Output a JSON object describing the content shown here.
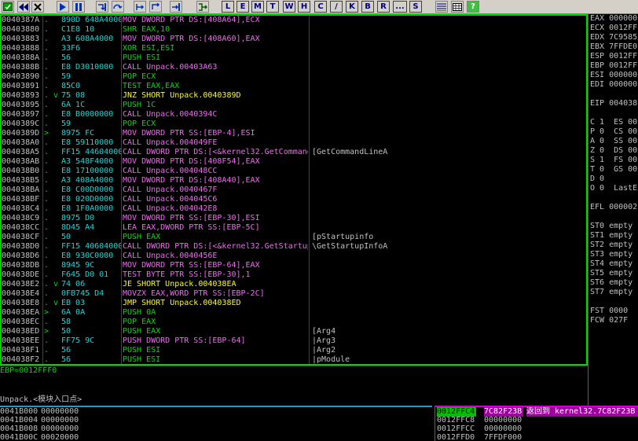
{
  "toolbar": {
    "icons": [
      "open-icon",
      "rewind-icon",
      "close-icon",
      "run-icon",
      "pause-icon",
      "step-into-icon",
      "step-over-icon",
      "trace-into-icon",
      "trace-over-icon",
      "execute-till-return-icon",
      "goto-icon"
    ],
    "letters": [
      "L",
      "E",
      "M",
      "T",
      "W",
      "H",
      "C",
      "/",
      "K",
      "B",
      "R",
      "...",
      "S"
    ],
    "right_icons": [
      "list-icon",
      "grid-icon",
      "help-icon"
    ]
  },
  "cpu": {
    "rows": [
      {
        "addr": "0040387A",
        "mark": ".",
        "hex": "890D 648A4000",
        "dis": "MOV DWORD PTR DS:[408A64],ECX",
        "type": "mov",
        "comment": ""
      },
      {
        "addr": "00403880",
        "mark": ".",
        "hex": "C1E8 10",
        "dis": "SHR EAX,10",
        "type": "default",
        "comment": ""
      },
      {
        "addr": "00403883",
        "mark": ".",
        "hex": "A3 608A4000",
        "dis": "MOV DWORD PTR DS:[408A60],EAX",
        "type": "mov",
        "comment": ""
      },
      {
        "addr": "00403888",
        "mark": ".",
        "hex": "33F6",
        "dis": "XOR ESI,ESI",
        "type": "default",
        "comment": ""
      },
      {
        "addr": "0040388A",
        "mark": ".",
        "hex": "56",
        "dis": "PUSH ESI",
        "type": "default",
        "comment": ""
      },
      {
        "addr": "0040388B",
        "mark": ".",
        "hex": "E8 D3010000",
        "dis": "CALL Unpack.00403A63",
        "type": "call",
        "comment": ""
      },
      {
        "addr": "00403890",
        "mark": ".",
        "hex": "59",
        "dis": "POP ECX",
        "type": "default",
        "comment": ""
      },
      {
        "addr": "00403891",
        "mark": ".",
        "hex": "85C0",
        "dis": "TEST EAX,EAX",
        "type": "default",
        "comment": ""
      },
      {
        "addr": "00403893",
        "mark": ". v",
        "hex": "75 08",
        "dis": "JNZ SHORT Unpack.0040389D",
        "type": "jmp",
        "comment": ""
      },
      {
        "addr": "00403895",
        "mark": ".",
        "hex": "6A 1C",
        "dis": "PUSH 1C",
        "type": "default",
        "comment": ""
      },
      {
        "addr": "00403897",
        "mark": ".",
        "hex": "E8 B0000000",
        "dis": "CALL Unpack.0040394C",
        "type": "call",
        "comment": ""
      },
      {
        "addr": "0040389C",
        "mark": ".",
        "hex": "59",
        "dis": "POP ECX",
        "type": "default",
        "comment": ""
      },
      {
        "addr": "0040389D",
        "mark": "> ",
        "hex": "8975 FC",
        "dis": "MOV DWORD PTR SS:[EBP-4],ESI",
        "type": "mov",
        "comment": ""
      },
      {
        "addr": "004038A0",
        "mark": ".",
        "hex": "E8 59110000",
        "dis": "CALL Unpack.004049FE",
        "type": "call",
        "comment": ""
      },
      {
        "addr": "004038A5",
        "mark": ".",
        "hex": "FF15 44604000",
        "dis": "CALL DWORD PTR DS:[<&kernel32.GetCommand",
        "type": "call",
        "comment": "[GetCommandLineA"
      },
      {
        "addr": "004038AB",
        "mark": ".",
        "hex": "A3 548F4000",
        "dis": "MOV DWORD PTR DS:[408F54],EAX",
        "type": "mov",
        "comment": ""
      },
      {
        "addr": "004038B0",
        "mark": ".",
        "hex": "E8 17100000",
        "dis": "CALL Unpack.004048CC",
        "type": "call",
        "comment": ""
      },
      {
        "addr": "004038B5",
        "mark": ".",
        "hex": "A3 408A4000",
        "dis": "MOV DWORD PTR DS:[408A40],EAX",
        "type": "mov",
        "comment": ""
      },
      {
        "addr": "004038BA",
        "mark": ".",
        "hex": "E8 C00D0000",
        "dis": "CALL Unpack.0040467F",
        "type": "call",
        "comment": ""
      },
      {
        "addr": "004038BF",
        "mark": ".",
        "hex": "E8 020D0000",
        "dis": "CALL Unpack.004045C6",
        "type": "call",
        "comment": ""
      },
      {
        "addr": "004038C4",
        "mark": ".",
        "hex": "E8 1F0A0000",
        "dis": "CALL Unpack.004042E8",
        "type": "call",
        "comment": ""
      },
      {
        "addr": "004038C9",
        "mark": ".",
        "hex": "8975 D0",
        "dis": "MOV DWORD PTR SS:[EBP-30],ESI",
        "type": "mov",
        "comment": ""
      },
      {
        "addr": "004038CC",
        "mark": ".",
        "hex": "8D45 A4",
        "dis": "LEA EAX,DWORD PTR SS:[EBP-5C]",
        "type": "mov",
        "comment": ""
      },
      {
        "addr": "004038CF",
        "mark": ".",
        "hex": "50",
        "dis": "PUSH EAX",
        "type": "default",
        "comment": "[pStartupinfo"
      },
      {
        "addr": "004038D0",
        "mark": ".",
        "hex": "FF15 40604000",
        "dis": "CALL DWORD PTR DS:[<&kernel32.GetStartup",
        "type": "call",
        "comment": "\\GetStartupInfoA"
      },
      {
        "addr": "004038D6",
        "mark": ".",
        "hex": "E8 930C0000",
        "dis": "CALL Unpack.0040456E",
        "type": "call",
        "comment": ""
      },
      {
        "addr": "004038DB",
        "mark": ".",
        "hex": "8945 9C",
        "dis": "MOV DWORD PTR SS:[EBP-64],EAX",
        "type": "mov",
        "comment": ""
      },
      {
        "addr": "004038DE",
        "mark": ".",
        "hex": "F645 D0 01",
        "dis": "TEST BYTE PTR SS:[EBP-30],1",
        "type": "mov",
        "comment": ""
      },
      {
        "addr": "004038E2",
        "mark": ". v",
        "hex": "74 06",
        "dis": "JE SHORT Unpack.004038EA",
        "type": "jmp",
        "comment": ""
      },
      {
        "addr": "004038E4",
        "mark": ".",
        "hex": "0FB745 D4",
        "dis": "MOVZX EAX,WORD PTR SS:[EBP-2C]",
        "type": "mov",
        "comment": ""
      },
      {
        "addr": "004038E8",
        "mark": ". v",
        "hex": "EB 03",
        "dis": "JMP SHORT Unpack.004038ED",
        "type": "jmp",
        "comment": ""
      },
      {
        "addr": "004038EA",
        "mark": "> ",
        "hex": "6A 0A",
        "dis": "PUSH 0A",
        "type": "default",
        "comment": ""
      },
      {
        "addr": "004038EC",
        "mark": ".",
        "hex": "58",
        "dis": "POP EAX",
        "type": "default",
        "comment": ""
      },
      {
        "addr": "004038ED",
        "mark": "> ",
        "hex": "50",
        "dis": "PUSH EAX",
        "type": "default",
        "comment": "[Arg4"
      },
      {
        "addr": "004038EE",
        "mark": ".",
        "hex": "FF75 9C",
        "dis": "PUSH DWORD PTR SS:[EBP-64]",
        "type": "mov",
        "comment": "|Arg3"
      },
      {
        "addr": "004038F1",
        "mark": ".",
        "hex": "56",
        "dis": "PUSH ESI",
        "type": "default",
        "comment": "|Arg2"
      },
      {
        "addr": "004038F2",
        "mark": ".",
        "hex": "56",
        "dis": "PUSH ESI",
        "type": "default",
        "comment": "|pModule"
      }
    ]
  },
  "info": {
    "line1": "EBP=0012FFF0",
    "line2": "Unpack.<模块入口点>"
  },
  "registers": {
    "lines": [
      "EAX 000000",
      "ECX 0012FF",
      "EDX 7C9585",
      "EBX 7FFDE0",
      "ESP 0012FF",
      "EBP 0012FF",
      "ESI 000000",
      "EDI 000000",
      "",
      "EIP 004038",
      "",
      "C 1  ES 00",
      "P 0  CS 00",
      "A 0  SS 00",
      "Z 0  DS 00",
      "S 1  FS 00",
      "T 0  GS 00",
      "D 0",
      "O 0  LastE",
      "",
      "EFL 000002",
      "",
      "ST0 empty",
      "ST1 empty",
      "ST2 empty",
      "ST3 empty",
      "ST4 empty",
      "ST5 empty",
      "ST6 empty",
      "ST7 empty",
      "",
      "FST 0000",
      "FCW 027F"
    ]
  },
  "dump": {
    "rows": [
      {
        "addr": "0041B000",
        "hex": "00000000"
      },
      {
        "addr": "0041B004",
        "hex": "00000000"
      },
      {
        "addr": "0041B008",
        "hex": "00000000"
      },
      {
        "addr": "0041B00C",
        "hex": "00020000"
      }
    ]
  },
  "stack": {
    "rows": [
      {
        "addr": "0012FFC4",
        "value": "7C82F23B",
        "comment": "返回到 kernel32.7C82F23B",
        "highlight": true
      },
      {
        "addr": "0012FFC8",
        "value": "00000000",
        "comment": "",
        "highlight": false
      },
      {
        "addr": "0012FFCC",
        "value": "00000000",
        "comment": "",
        "highlight": false
      },
      {
        "addr": "0012FFD0",
        "value": "7FFDF000",
        "comment": "",
        "highlight": false
      }
    ]
  },
  "colors": {
    "cpu_border": "#00d000",
    "dump_border": "#3090d0",
    "stack_border": "#d000d0",
    "highlight_bg": "#00c000",
    "comment_highlight_bg": "#a000a0"
  }
}
